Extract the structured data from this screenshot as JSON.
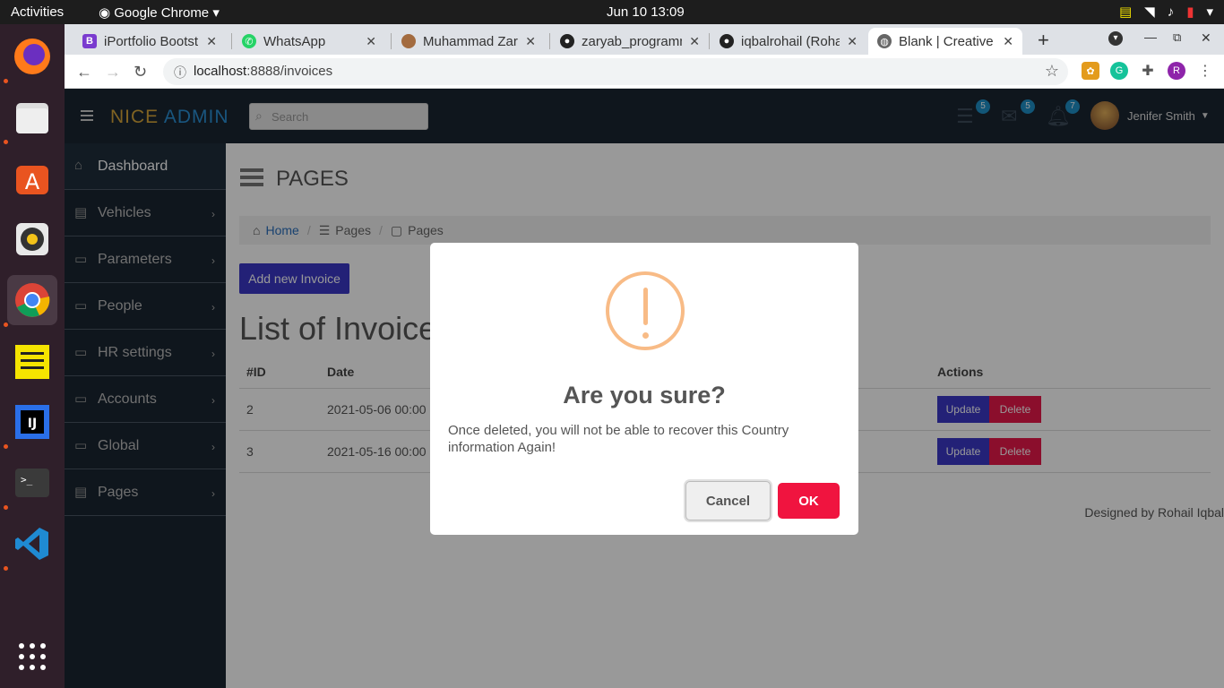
{
  "system": {
    "activities": "Activities",
    "app_name": "Google Chrome",
    "clock": "Jun 10  13:09"
  },
  "dock": {
    "items": [
      "firefox-icon",
      "files-icon",
      "software-icon",
      "rhythmbox-icon",
      "chrome-icon",
      "notes-icon",
      "intellij-icon",
      "terminal-icon",
      "vscode-icon",
      "apps-grid-icon"
    ]
  },
  "browser": {
    "tabs": [
      {
        "title": "iPortfolio Bootstrap",
        "icon": "bootstrap-icon"
      },
      {
        "title": "WhatsApp",
        "icon": "whatsapp-icon"
      },
      {
        "title": "Muhammad Zaryab",
        "icon": "avatar-icon"
      },
      {
        "title": "zaryab_programmer",
        "icon": "github-icon"
      },
      {
        "title": "iqbalrohail (Rohail)",
        "icon": "github-icon"
      },
      {
        "title": "Blank | Creative",
        "icon": "globe-icon"
      }
    ],
    "url_host": "localhost",
    "url_path": ":8888/invoices",
    "profile_initial": "R"
  },
  "app": {
    "brand_nice": "NICE",
    "brand_admin": "ADMIN",
    "search_placeholder": "Search",
    "badges": {
      "tasks": "5",
      "messages": "5",
      "notifications": "7"
    },
    "user_name": "Jenifer Smith",
    "sidebar": [
      {
        "label": "Dashboard"
      },
      {
        "label": "Vehicles"
      },
      {
        "label": "Parameters"
      },
      {
        "label": "People"
      },
      {
        "label": "HR settings"
      },
      {
        "label": "Accounts"
      },
      {
        "label": "Global"
      },
      {
        "label": "Pages"
      }
    ],
    "page_title": "PAGES",
    "breadcrumb": {
      "home": "Home",
      "pages1": "Pages",
      "pages2": "Pages"
    },
    "add_button": "Add new Invoice",
    "list_title": "List of Invoices",
    "table": {
      "headers": {
        "id": "#ID",
        "date": "Date",
        "actions": "Actions"
      },
      "rows": [
        {
          "id": "2",
          "date": "2021-05-06 00:00"
        },
        {
          "id": "3",
          "date": "2021-05-16 00:00"
        }
      ],
      "update_label": "Update",
      "delete_label": "Delete"
    },
    "footer": "Designed by Rohail Iqbal"
  },
  "modal": {
    "title": "Are you sure?",
    "message": "Once deleted, you will not be able to recover this Country information Again!",
    "cancel": "Cancel",
    "ok": "OK"
  },
  "colors": {
    "primary_button": "#3b38c6",
    "delete": "#e8184a",
    "ok": "#f0143f",
    "warning": "#f8bb86"
  }
}
